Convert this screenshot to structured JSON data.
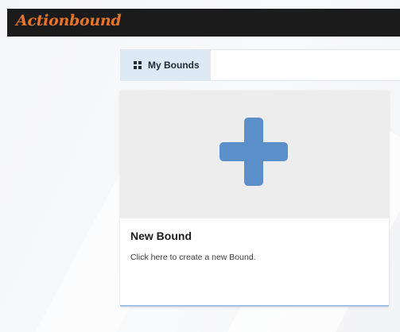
{
  "app": {
    "logo_text": "Actionbound",
    "brand_color": "#e8742a"
  },
  "tabs": [
    {
      "label": "My Bounds",
      "icon": "grid-icon",
      "active": true
    }
  ],
  "card": {
    "title": "New Bound",
    "description": "Click here to create a new Bound.",
    "icon": "plus-icon",
    "icon_color": "#5b8fca"
  }
}
